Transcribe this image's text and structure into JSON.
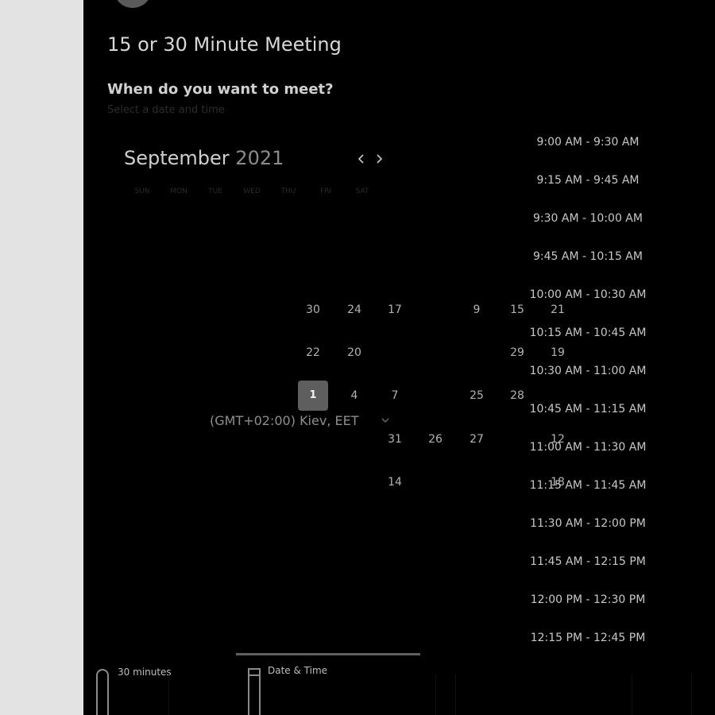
{
  "meeting": {
    "title": "15 or 30 Minute Meeting",
    "question": "When do you want to meet?",
    "subtitle": "Select a date and time"
  },
  "calendar": {
    "month": "September",
    "year": "2021",
    "weekdays": [
      "SUN",
      "MON",
      "TUE",
      "WED",
      "THU",
      "FRI",
      "SAT"
    ],
    "days": [
      "30",
      "24",
      "17",
      "9",
      "15",
      "21",
      "22",
      "20",
      "29",
      "19",
      "1",
      "4",
      "7",
      "25",
      "28",
      "31",
      "26",
      "27",
      "12",
      "14",
      "18"
    ],
    "selected_day": "1"
  },
  "timezone": {
    "label": "(GMT+02:00) Kiev, EET"
  },
  "time_slots": [
    "9:00 AM - 9:30 AM",
    "9:15 AM - 9:45 AM",
    "9:30 AM - 10:00 AM",
    "9:45 AM - 10:15 AM",
    "10:00 AM - 10:30 AM",
    "10:15 AM - 10:45 AM",
    "10:30 AM - 11:00 AM",
    "10:45 AM - 11:15 AM",
    "11:00 AM - 11:30 AM",
    "11:15 AM - 11:45 AM",
    "11:30 AM - 12:00 PM",
    "11:45 AM - 12:15 PM",
    "12:00 PM - 12:30 PM",
    "12:15 PM - 12:45 PM"
  ],
  "footer_tabs": {
    "duration_label": "30 minutes",
    "date_time_label": "Date & Time"
  },
  "icons": {
    "prev": "chevron-left-icon",
    "next": "chevron-right-icon",
    "timezone": "chevron-down-icon"
  },
  "colors": {
    "background": "#000000",
    "gutter": "#e3e3e3",
    "selected_day": "#5e5e5e",
    "text_primary": "#d7d7d7"
  }
}
